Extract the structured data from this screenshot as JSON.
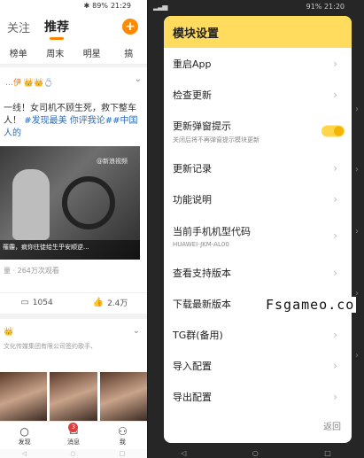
{
  "left": {
    "status": {
      "bluetooth": "✱",
      "battery": "89%",
      "time": "21:29"
    },
    "tabs": [
      {
        "label": "关注",
        "active": false
      },
      {
        "label": "推荐",
        "active": true
      }
    ],
    "subtabs": [
      "榜单",
      "周末",
      "明星",
      "搞"
    ],
    "post1": {
      "user": "…伊 👑👑💍",
      "text_before": "一线！女司机不顾生死，救下整车人！",
      "tags": "#发现最美 你评我论##中国人的",
      "watermark": "@新浪视频",
      "caption": "罹霾，疯你往徒给生乎安顺逆...",
      "views": "量 · 264万次观看",
      "comments": "1054",
      "likes": "2.4万"
    },
    "post2": {
      "user": "👑",
      "desc": "文化传媒集团有限公司签约歌手、"
    },
    "nav": [
      {
        "icon": "search",
        "label": "发现"
      },
      {
        "icon": "mail",
        "label": "消息",
        "badge": "3"
      },
      {
        "icon": "person",
        "label": "我"
      }
    ]
  },
  "right": {
    "status": {
      "battery": "91%",
      "time": "21:20"
    },
    "dialog": {
      "title": "模块设置",
      "items": [
        {
          "title": "重启App"
        },
        {
          "title": "检查更新"
        },
        {
          "title": "更新弹窗提示",
          "subtitle": "关闭后将不再弹窗提示模块更新",
          "toggle": true
        },
        {
          "title": "更新记录"
        },
        {
          "title": "功能说明"
        },
        {
          "title": "当前手机机型代码",
          "subtitle": "HUAWEI-JKM-AL00"
        },
        {
          "title": "查看支持版本"
        },
        {
          "title": "下载最新版本"
        },
        {
          "title": "TG群(备用)"
        },
        {
          "title": "导入配置"
        },
        {
          "title": "导出配置"
        }
      ],
      "back_label": "返回"
    }
  },
  "watermark_text": "Fsgameo.co",
  "accent_color": "#ffdc5e"
}
